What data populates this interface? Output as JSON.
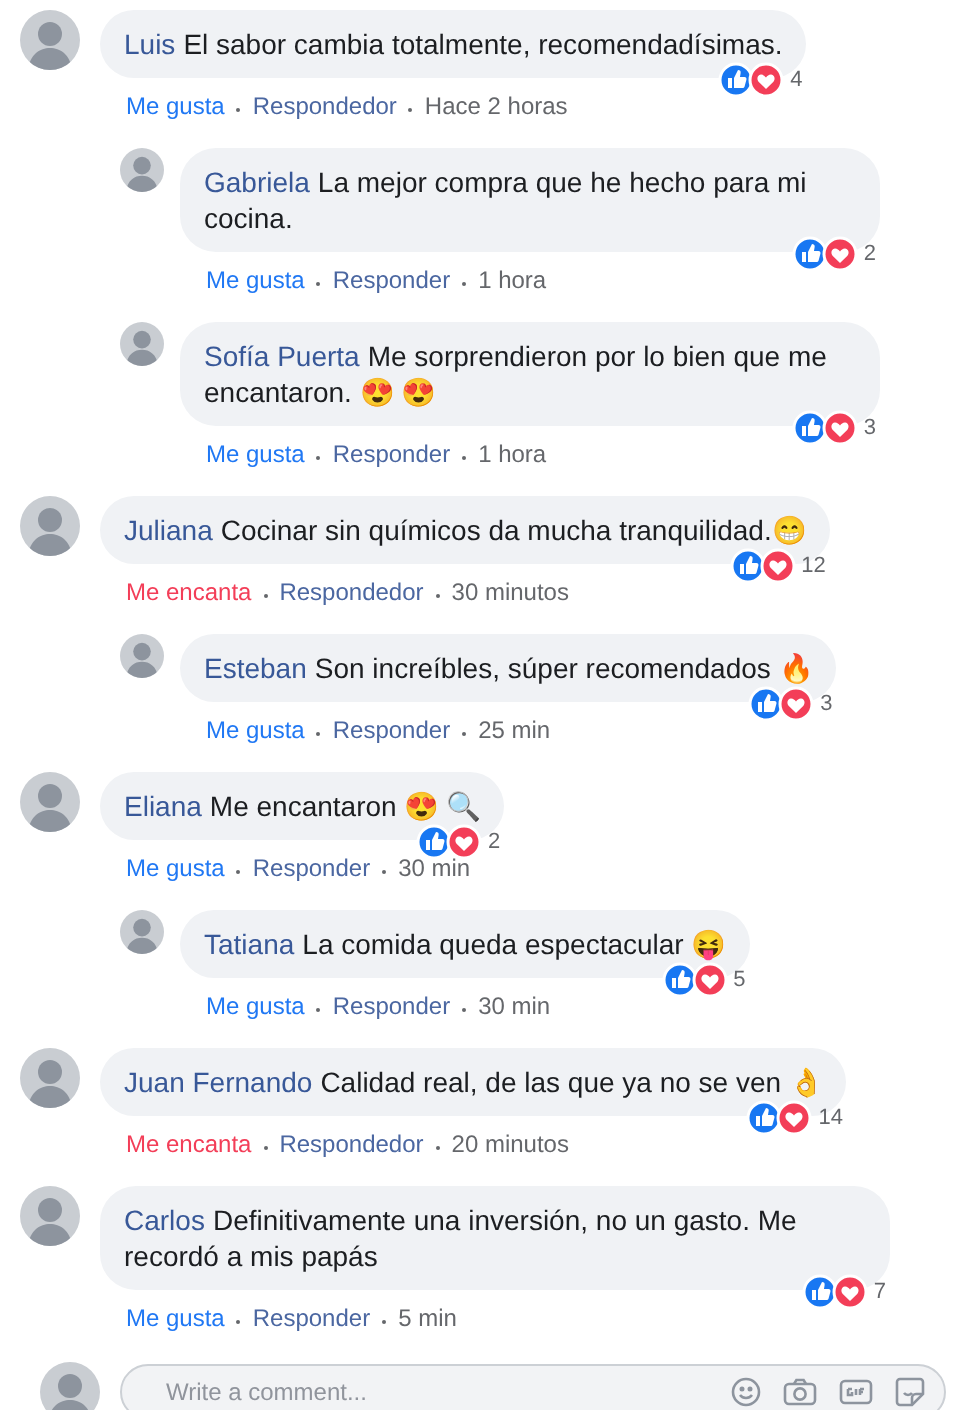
{
  "comments": [
    {
      "author": "Luis",
      "text": "El sabor cambia totalmente, recomendadísimas.",
      "reaction_count": "4",
      "action": {
        "label": "Me gusta",
        "kind": "like"
      },
      "reply_label": "Respondedor",
      "time": "Hace 2 horas",
      "children": [
        {
          "author": "Gabriela",
          "text": "La mejor compra que he hecho para mi cocina.",
          "reaction_count": "2",
          "action": {
            "label": "Me gusta",
            "kind": "like"
          },
          "reply_label": "Responder",
          "time": "1 hora"
        },
        {
          "author": "Sofía Puerta",
          "text": "Me sorprendieron por lo bien que me encantaron. 😍 😍",
          "reaction_count": "3",
          "action": {
            "label": "Me gusta",
            "kind": "like"
          },
          "reply_label": "Responder",
          "time": "1 hora"
        }
      ]
    },
    {
      "author": "Juliana",
      "text": "Cocinar sin químicos da mucha tranquilidad.😁",
      "reaction_count": "12",
      "action": {
        "label": "Me encanta",
        "kind": "love"
      },
      "reply_label": "Respondedor",
      "time": "30 minutos",
      "children": [
        {
          "author": "Esteban",
          "text": "Son increíbles, súper recomendados 🔥",
          "reaction_count": "3",
          "action": {
            "label": "Me gusta",
            "kind": "like"
          },
          "reply_label": "Responder",
          "time": "25 min"
        }
      ]
    },
    {
      "author": "Eliana",
      "text": "Me encantaron 😍 🔍",
      "reaction_count": "2",
      "action": {
        "label": "Me gusta",
        "kind": "like"
      },
      "reply_label": "Responder",
      "time": "30 min",
      "children": [
        {
          "author": "Tatiana",
          "text": "La comida queda espectacular 😝",
          "reaction_count": "5",
          "action": {
            "label": "Me gusta",
            "kind": "like"
          },
          "reply_label": "Responder",
          "time": "30 min"
        }
      ]
    },
    {
      "author": "Juan Fernando",
      "text": "Calidad real, de las que ya no se ven 👌",
      "reaction_count": "14",
      "action": {
        "label": "Me encanta",
        "kind": "love"
      },
      "reply_label": "Respondedor",
      "time": "20 minutos"
    },
    {
      "author": "Carlos",
      "text": "Definitivamente una inversión, no un gasto. Me recordó a mis papás",
      "reaction_count": "7",
      "action": {
        "label": "Me gusta",
        "kind": "like"
      },
      "reply_label": "Responder",
      "time": "5 min"
    }
  ],
  "composer": {
    "placeholder": "Write a comment..."
  }
}
